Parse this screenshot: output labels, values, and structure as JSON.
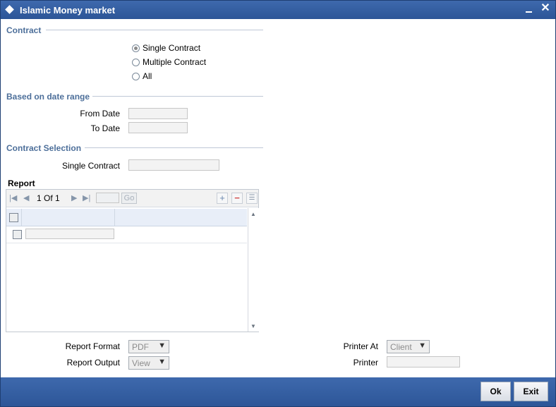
{
  "window": {
    "title": "Islamic Money market"
  },
  "contract": {
    "section_title": "Contract",
    "options": [
      {
        "label": "Single Contract",
        "checked": true
      },
      {
        "label": "Multiple Contract",
        "checked": false
      },
      {
        "label": "All",
        "checked": false
      }
    ]
  },
  "date_range": {
    "section_title": "Based on date range",
    "from_label": "From Date",
    "from_value": "",
    "to_label": "To Date",
    "to_value": ""
  },
  "contract_selection": {
    "section_title": "Contract Selection",
    "single_label": "Single Contract",
    "single_value": ""
  },
  "report": {
    "label": "Report",
    "pager": {
      "current": "1",
      "of_label": "Of",
      "total": "1",
      "go_label": "Go"
    }
  },
  "options": {
    "report_format_label": "Report Format",
    "report_format_value": "PDF",
    "report_output_label": "Report Output",
    "report_output_value": "View",
    "printer_at_label": "Printer At",
    "printer_at_value": "Client",
    "printer_label": "Printer",
    "printer_value": ""
  },
  "footer": {
    "ok_label": "Ok",
    "exit_label": "Exit"
  },
  "colors": {
    "title_bar": "#2c5597",
    "section_title": "#4d6f9a",
    "footer_bar": "#2d5698"
  }
}
